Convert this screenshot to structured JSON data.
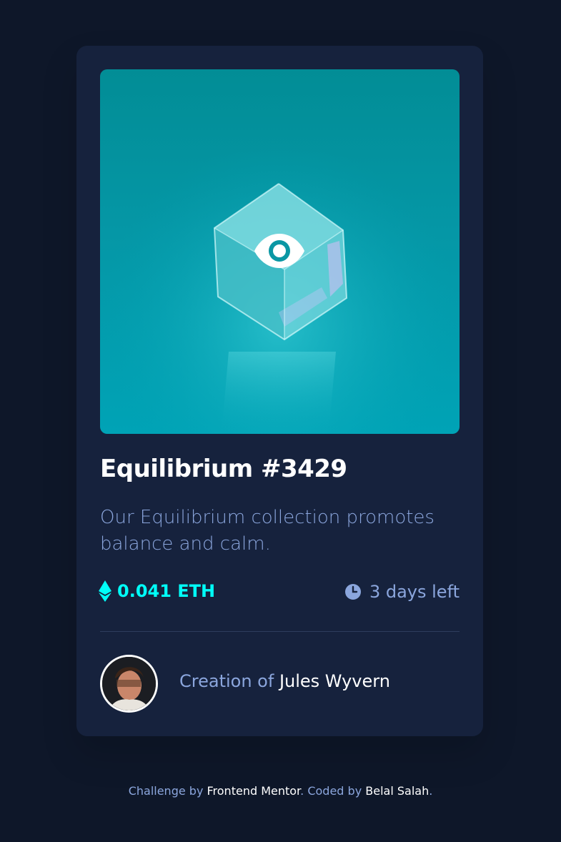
{
  "card": {
    "image_alt": "Equilibrium crystal cube",
    "overlay_icon": "eye-icon",
    "title": "Equilibrium #3429",
    "description": "Our Equilibrium collection promotes balance and calm.",
    "price": {
      "icon": "ethereum-icon",
      "value": "0.041 ETH"
    },
    "time_left": {
      "icon": "clock-icon",
      "value": "3 days left"
    },
    "creator": {
      "prefix": "Creation of ",
      "name": "Jules Wyvern"
    }
  },
  "footer": {
    "challenge_prefix": "Challenge by ",
    "challenge_link": "Frontend Mentor",
    "coded_prefix": ". Coded by ",
    "coded_link": "Belal Salah",
    "suffix": "."
  },
  "colors": {
    "background": "#0e1729",
    "card": "#16223d",
    "cyan": "#00fff8",
    "soft_blue": "#8ba6dd",
    "white": "#ffffff"
  }
}
